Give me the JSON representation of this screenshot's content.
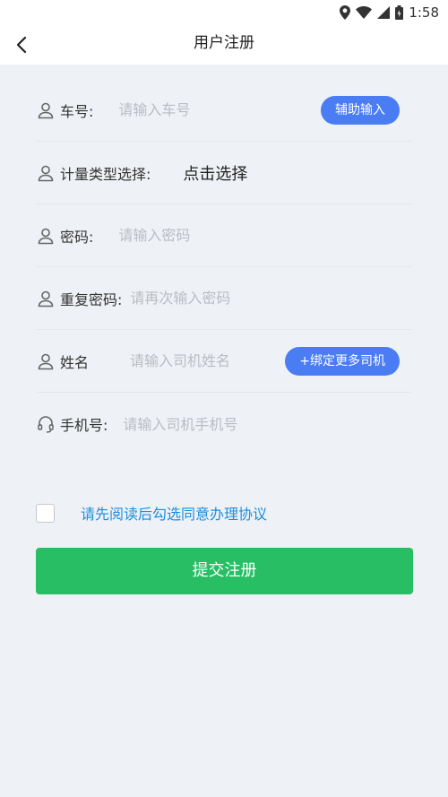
{
  "status_bar": {
    "time": "1:58"
  },
  "header": {
    "title": "用户注册"
  },
  "form": {
    "plate": {
      "label": "车号:",
      "placeholder": "请输入车号",
      "assist_button": "辅助输入"
    },
    "meter_type": {
      "label": "计量类型选择:",
      "value": "点击选择"
    },
    "password": {
      "label": "密码:",
      "placeholder": "请输入密码"
    },
    "confirm_password": {
      "label": "重复密码:",
      "placeholder": "请再次输入密码"
    },
    "name": {
      "label": "姓名",
      "placeholder": "请输入司机姓名",
      "bind_button": "+绑定更多司机"
    },
    "phone": {
      "label": "手机号:",
      "placeholder": "请输入司机手机号"
    }
  },
  "agreement": {
    "text": "请先阅读后勾选同意办理协议",
    "checked": false
  },
  "submit_button": "提交注册",
  "colors": {
    "accent_blue": "#4a7cf3",
    "link_blue": "#1a8fe0",
    "submit_green": "#28be64",
    "background": "#eef1f5"
  }
}
